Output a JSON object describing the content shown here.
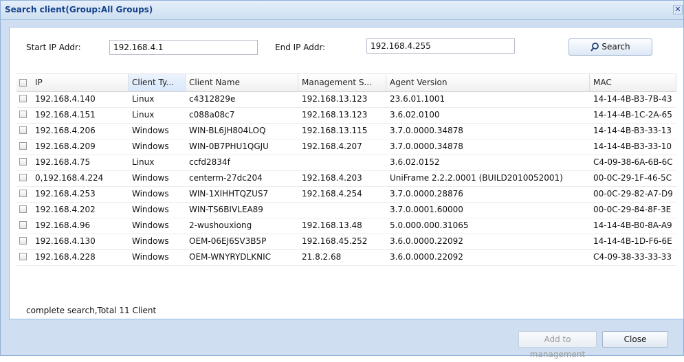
{
  "dialog": {
    "title": "Search client(Group:All Groups)",
    "close_glyph": "✕"
  },
  "search": {
    "start_label": "Start IP Addr:",
    "start_value": "192.168.4.1",
    "end_label": "End IP Addr:",
    "end_value": "192.168.4.255",
    "button_label": "Search",
    "button_icon": "magnifier-icon"
  },
  "table": {
    "columns": [
      "IP",
      "Client Ty...",
      "Client Name",
      "Management S...",
      "Agent Version",
      "MAC"
    ],
    "sorted_column": "Client Ty...",
    "rows": [
      [
        "192.168.4.140",
        "Linux",
        "c4312829e",
        "192.168.13.123",
        "23.6.01.1001",
        "14-14-4B-B3-7B-43"
      ],
      [
        "192.168.4.151",
        "Linux",
        "c088a08c7",
        "192.168.13.123",
        "3.6.02.0100",
        "14-14-4B-1C-2A-65"
      ],
      [
        "192.168.4.206",
        "Windows",
        "WIN-BL6JH804LOQ",
        "192.168.13.115",
        "3.7.0.0000.34878",
        "14-14-4B-B3-33-13"
      ],
      [
        "192.168.4.209",
        "Windows",
        "WIN-0B7PHU1QGJU",
        "192.168.4.207",
        "3.7.0.0000.34878",
        "14-14-4B-B3-33-10"
      ],
      [
        "192.168.4.75",
        "Linux",
        "ccfd2834f",
        "",
        "3.6.02.0152",
        "C4-09-38-6A-6B-6C"
      ],
      [
        "0,192.168.4.224",
        "Windows",
        "centerm-27dc204",
        "192.168.4.203",
        "UniFrame 2.2.2.0001 (BUILD2010052001)",
        "00-0C-29-1F-46-5C"
      ],
      [
        "192.168.4.253",
        "Windows",
        "WIN-1XIHHTQZUS7",
        "192.168.4.254",
        "3.7.0.0000.28876",
        "00-0C-29-82-A7-D9"
      ],
      [
        "192.168.4.202",
        "Windows",
        "WIN-TS6BIVLEA89",
        "",
        "3.7.0.0001.60000",
        "00-0C-29-84-8F-3E"
      ],
      [
        "192.168.4.96",
        "Windows",
        "2-wushouxiong",
        "192.168.13.48",
        "5.0.000.000.31065",
        "14-14-4B-B0-8A-A9"
      ],
      [
        "192.168.4.130",
        "Windows",
        "OEM-06EJ6SV3B5P",
        "192.168.45.252",
        "3.6.0.0000.22092",
        "14-14-4B-1D-F6-6E"
      ],
      [
        "192.168.4.228",
        "Windows",
        "OEM-WNYRYDLKNIC",
        "21.8.2.68",
        "3.6.0.0000.22092",
        "C4-09-38-33-33-33"
      ]
    ]
  },
  "status": {
    "text": "complete search,Total 11 Client"
  },
  "footer": {
    "add_label": "Add to management",
    "close_label": "Close"
  },
  "colors": {
    "title_text": "#15428b",
    "dialog_bg": "#cfdff1",
    "panel_border": "#99bbe8",
    "disabled_text": "#9a9a9a"
  }
}
